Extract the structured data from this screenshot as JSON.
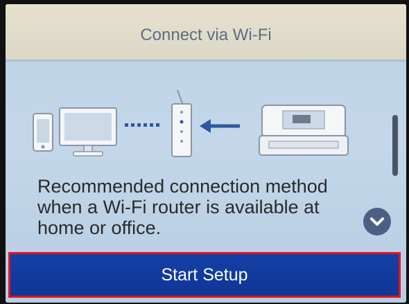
{
  "header": {
    "title": "Connect via Wi-Fi"
  },
  "content": {
    "description": "Recommended connection method\nwhen a Wi-Fi router is available at\nhome or office."
  },
  "icons": {
    "phone": "smartphone-icon",
    "monitor": "computer-icon",
    "router": "router-icon",
    "arrow": "arrow-left-icon",
    "printer": "printer-icon",
    "scroll_down": "chevron-down-icon"
  },
  "actions": {
    "start_setup_label": "Start Setup"
  },
  "colors": {
    "button_blue": "#1540a6",
    "highlight_red": "#e3141f",
    "title_text": "#5d6d82",
    "icon_blue": "#2c5aa0"
  }
}
